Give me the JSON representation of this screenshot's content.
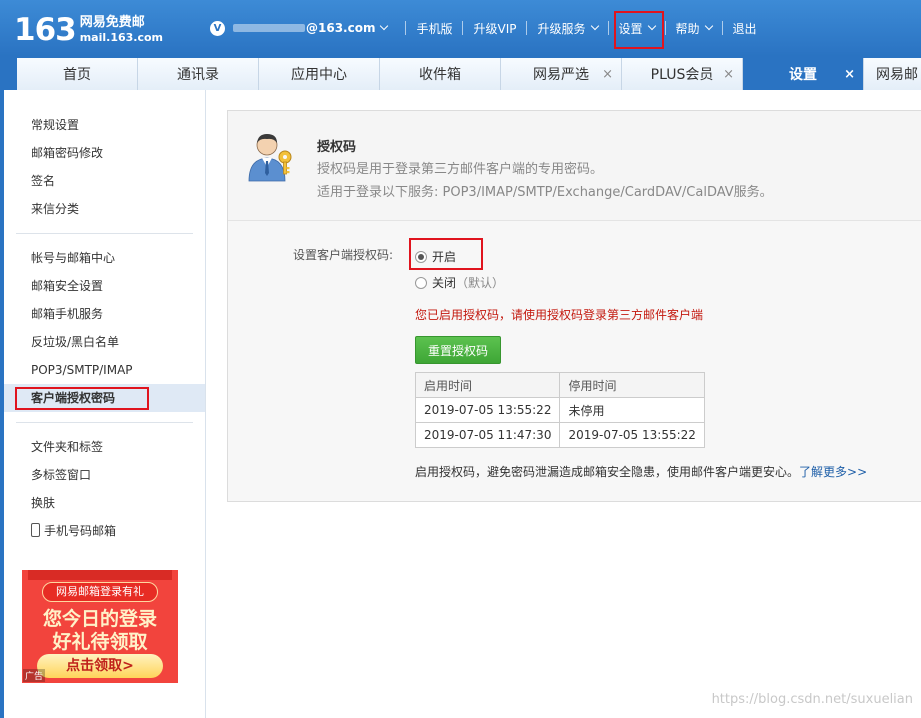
{
  "header": {
    "logo_number": "163",
    "logo_cn": "网易免费邮",
    "logo_en": "mail.163.com",
    "vip_badge": "V",
    "email_visible": "@163.com",
    "nav": [
      "手机版",
      "升级VIP",
      "升级服务",
      "设置",
      "帮助",
      "退出"
    ]
  },
  "tabs": [
    {
      "label": "首页"
    },
    {
      "label": "通讯录"
    },
    {
      "label": "应用中心"
    },
    {
      "label": "收件箱"
    },
    {
      "label": "网易严选",
      "close": "×"
    },
    {
      "label": "PLUS会员",
      "close": "×"
    },
    {
      "label": "设置",
      "close": "×"
    },
    {
      "label": "网易邮"
    }
  ],
  "sidebar": {
    "group1": [
      "常规设置",
      "邮箱密码修改",
      "签名",
      "来信分类"
    ],
    "group2": [
      "帐号与邮箱中心",
      "邮箱安全设置",
      "邮箱手机服务",
      "反垃圾/黑白名单",
      "POP3/SMTP/IMAP",
      "客户端授权密码"
    ],
    "group3": [
      "文件夹和标签",
      "多标签窗口",
      "换肤",
      "手机号码邮箱"
    ],
    "active": "客户端授权密码"
  },
  "ad": {
    "pill": "网易邮箱登录有礼",
    "line1": "您今日的登录",
    "line2": "好礼待领取",
    "button": "点击领取>",
    "tag": "广告"
  },
  "panel": {
    "title": "授权码",
    "desc1": "授权码是用于登录第三方邮件客户端的专用密码。",
    "desc2": "适用于登录以下服务: POP3/IMAP/SMTP/Exchange/CardDAV/CalDAV服务。",
    "field_label": "设置客户端授权码:",
    "option_on": "开启",
    "option_off": "关闭",
    "option_off_note": "（默认）",
    "selected": "开启",
    "notice": "您已启用授权码，请使用授权码登录第三方邮件客户端",
    "reset_button": "重置授权码",
    "table_headers": [
      "启用时间",
      "停用时间"
    ],
    "table_rows": [
      [
        "2019-07-05 13:55:22",
        "未停用"
      ],
      [
        "2019-07-05 11:47:30",
        "2019-07-05 13:55:22"
      ]
    ],
    "footer_text": "启用授权码，避免密码泄漏造成邮箱安全隐患，使用邮件客户端更安心。",
    "footer_link": "了解更多>>"
  },
  "watermark": "https://blog.csdn.net/suxuelian",
  "colors": {
    "brand_blue": "#2a73c2",
    "highlight_red": "#e0141e",
    "notice_red": "#c3190f",
    "button_green": "#4bb243"
  }
}
